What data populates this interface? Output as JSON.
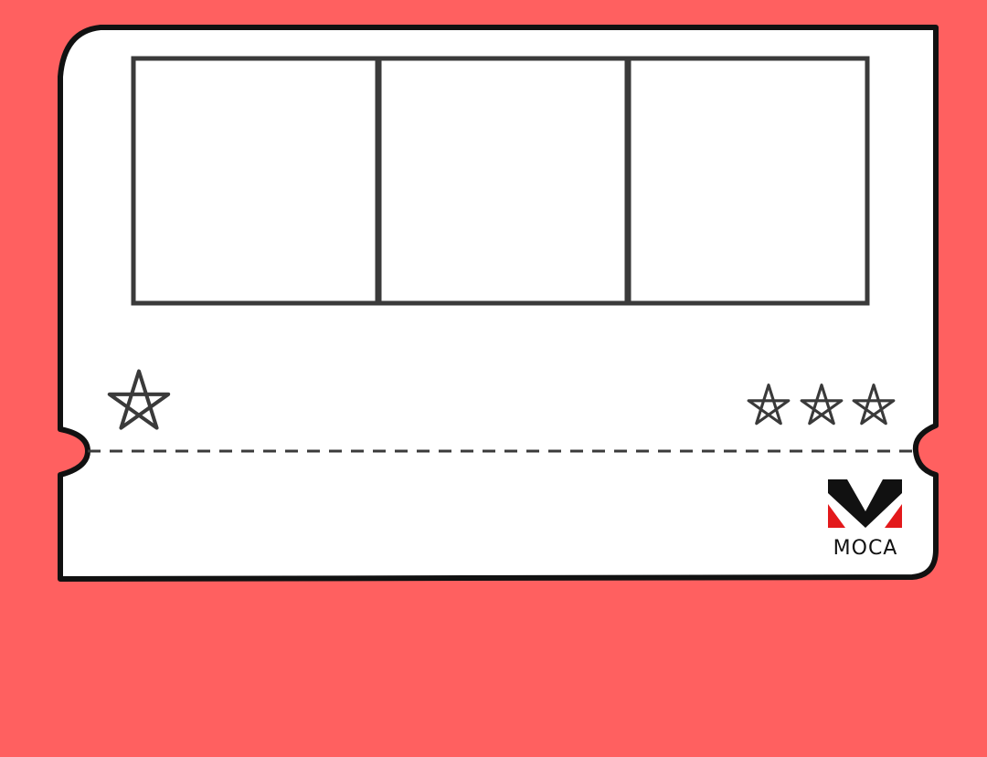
{
  "colors": {
    "background": "#ff6060",
    "ticket_fill": "#ffffff",
    "ink": "#111111",
    "frame_stroke": "#3a3a3a",
    "logo_black": "#111111",
    "logo_red": "#e3191b"
  },
  "ticket": {
    "panels": [
      {
        "name": "panel-left"
      },
      {
        "name": "panel-middle"
      },
      {
        "name": "panel-right"
      }
    ],
    "left_star_icon": "star-outline-icon",
    "right_stars": [
      "star-outline-icon",
      "star-outline-icon",
      "star-outline-icon"
    ],
    "perforation": "dashed-tear-line"
  },
  "logo": {
    "icon": "moca-m-logo-icon",
    "text": "MOCA"
  }
}
